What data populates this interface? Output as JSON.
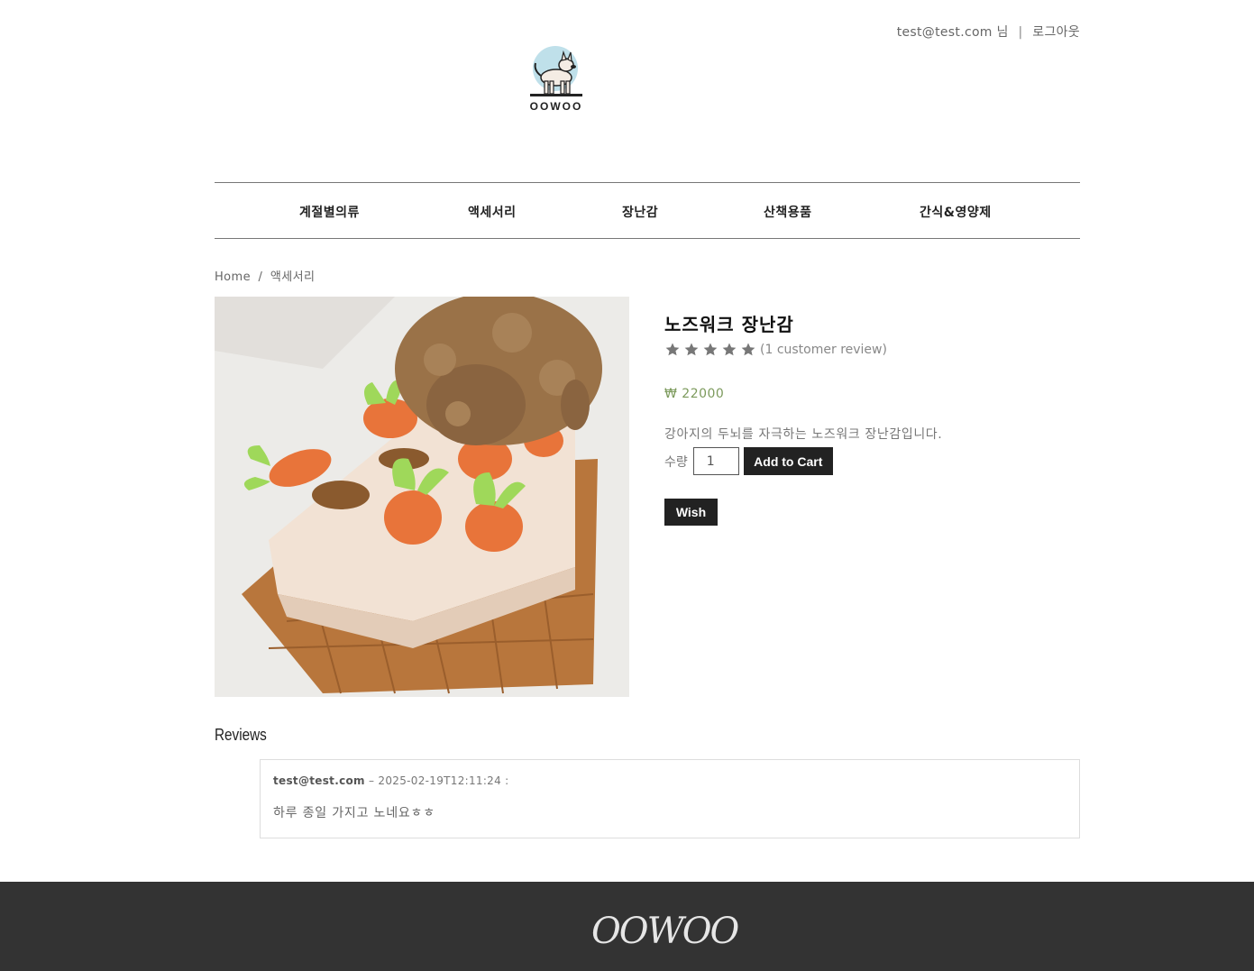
{
  "header": {
    "user_email": "test@test.com",
    "user_suffix": "님",
    "separator": "|",
    "logout_label": "로그아웃",
    "logo_text": "OOWOO"
  },
  "nav": {
    "items": [
      "계절별의류",
      "액세서리",
      "장난감",
      "산책용품",
      "간식&영양제"
    ]
  },
  "breadcrumb": {
    "home": "Home",
    "separator": "/",
    "current": "액세서리"
  },
  "product": {
    "title": "노즈워크 장난감",
    "rating_stars": 5,
    "review_count_text": "(1 customer review)",
    "price": "₩ 22000",
    "description": "강아지의 두뇌를 자극하는 노즈워크 장난감입니다.",
    "quantity_label": "수량",
    "quantity_value": "1",
    "add_to_cart_label": "Add to Cart",
    "wish_label": "Wish"
  },
  "reviews": {
    "heading": "Reviews",
    "items": [
      {
        "author": "test@test.com",
        "dash": "–",
        "date": "2025-02-19T12:11:24 :",
        "text": "하루 종일 가지고 노네요ㅎㅎ"
      }
    ]
  },
  "footer": {
    "logo_text": "OOWOO"
  },
  "colors": {
    "price": "#7c9a5c",
    "button": "#222222",
    "footer": "#333333"
  }
}
